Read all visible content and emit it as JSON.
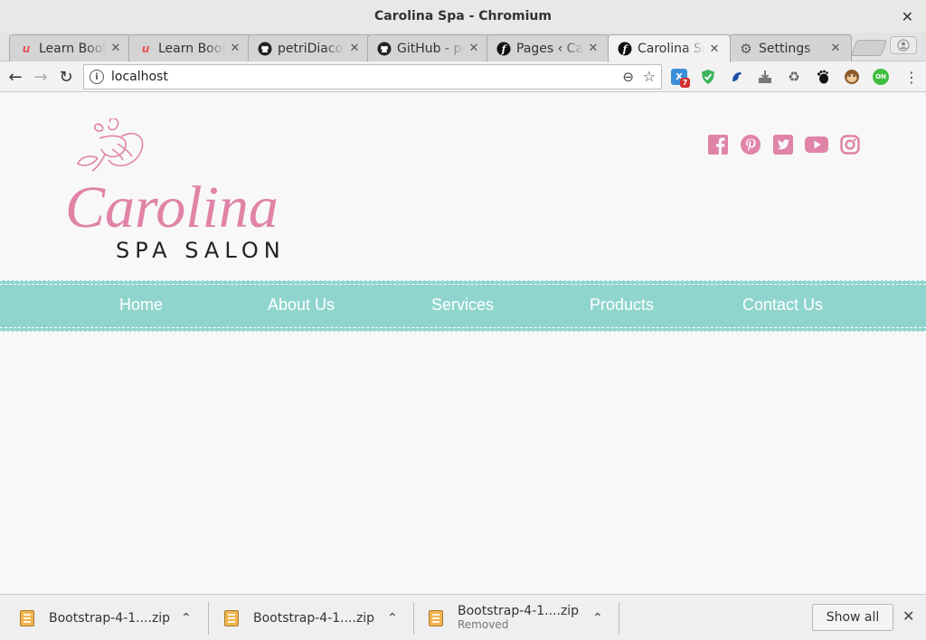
{
  "window": {
    "title": "Carolina Spa - Chromium",
    "close_glyph": "✕"
  },
  "tabs": [
    {
      "label": "Learn Bootstrap",
      "icon": "udemy-icon"
    },
    {
      "label": "Learn Bootstrap",
      "icon": "udemy-icon"
    },
    {
      "label": "petriDiacon",
      "icon": "github-icon"
    },
    {
      "label": "GitHub - petri",
      "icon": "github-icon"
    },
    {
      "label": "Pages ‹ Carolina",
      "icon": "symfony-icon"
    },
    {
      "label": "Carolina Spa",
      "icon": "symfony-icon",
      "active": true
    },
    {
      "label": "Settings",
      "icon": "gear-icon"
    }
  ],
  "toolbar": {
    "back": "←",
    "forward": "→",
    "reload": "↻",
    "url": "localhost",
    "zoom_glyph": "⊖",
    "star_glyph": "☆",
    "menu_glyph": "⋮",
    "ext_badge": "7"
  },
  "site": {
    "logo_script": "Carolina",
    "logo_sub": "SPA SALON",
    "brand_color": "#e083a7",
    "nav": [
      "Home",
      "About Us",
      "Services",
      "Products",
      "Contact Us"
    ],
    "nav_bg": "#8fd5ce",
    "social": [
      "facebook-icon",
      "pinterest-icon",
      "twitter-icon",
      "youtube-icon",
      "instagram-icon"
    ]
  },
  "downloads": {
    "items": [
      {
        "name": "Bootstrap-4-1....zip",
        "status": ""
      },
      {
        "name": "Bootstrap-4-1....zip",
        "status": ""
      },
      {
        "name": "Bootstrap-4-1....zip",
        "status": "Removed"
      }
    ],
    "show_all": "Show all",
    "caret": "⌃",
    "close_glyph": "✕"
  }
}
